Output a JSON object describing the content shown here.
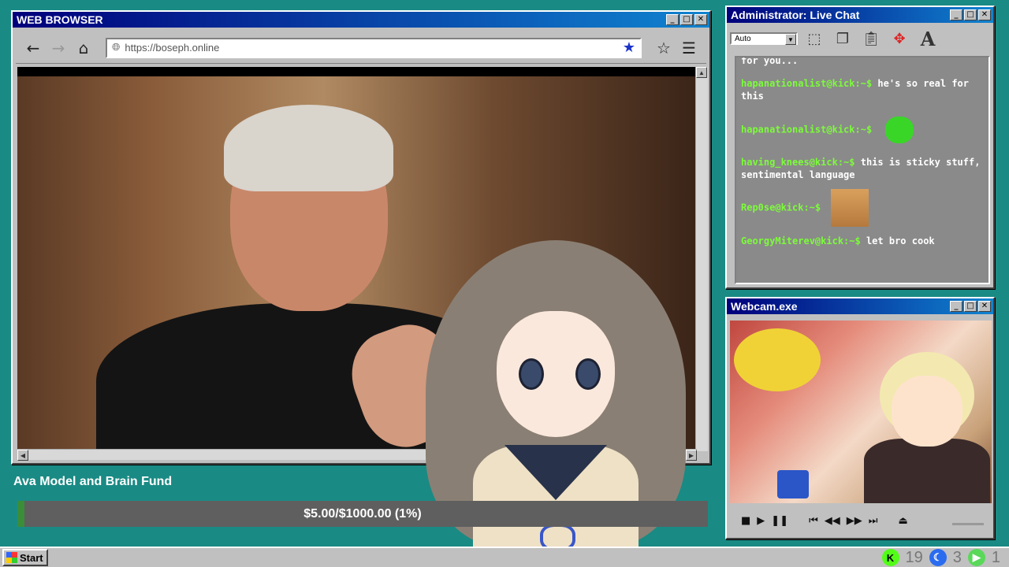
{
  "browser": {
    "title": "WEB BROWSER",
    "url": "https://boseph.online"
  },
  "chat": {
    "title": "Administrator: Live Chat",
    "zoom_select": "Auto",
    "partial_line": "for you...",
    "messages": [
      {
        "user": "hapanationalist@kick:~$",
        "text": "he's so real for this"
      },
      {
        "user": "hapanationalist@kick:~$",
        "text": "",
        "emote": "green-face"
      },
      {
        "user": "having_knees@kick:~$",
        "text": "this is sticky stuff, sentimental language"
      },
      {
        "user": "Rep0se@kick:~$",
        "text": "",
        "emote": "cat-face"
      },
      {
        "user": "GeorgyMiterev@kick:~$",
        "text": "let bro cook"
      }
    ]
  },
  "webcam": {
    "title": "Webcam.exe"
  },
  "fund": {
    "title": "Ava Model and Brain Fund",
    "progress_text": "$5.00/$1000.00 (1%)",
    "progress_fraction": 0.01
  },
  "taskbar": {
    "start_label": "Start",
    "tray": [
      {
        "icon": "kick-icon",
        "count": "19",
        "color": "#53fc18"
      },
      {
        "icon": "moon-icon",
        "count": "3",
        "color": "#2a6cf0"
      },
      {
        "icon": "play-icon",
        "count": "1",
        "color": "#5ad85a"
      }
    ]
  }
}
